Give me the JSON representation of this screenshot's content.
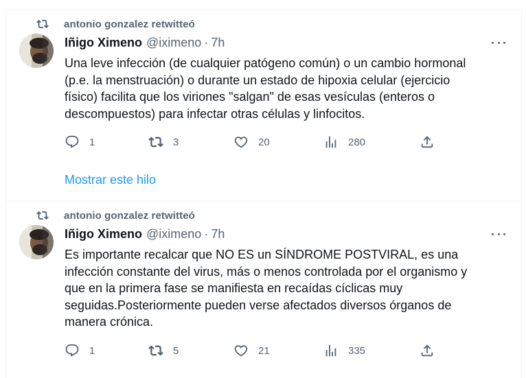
{
  "colors": {
    "text": "#0f1419",
    "muted": "#536471",
    "link": "#1d9bf0",
    "divider": "#eff3f4"
  },
  "tweets": [
    {
      "retweet_text": "antonio gonzalez retwitteó",
      "name": "Iñigo Ximeno",
      "handle": "@iximeno",
      "separator": "·",
      "time": "7h",
      "lines": [
        "Una leve infección (de cualquier patógeno común) o un cambio hormonal",
        "(p.e. la menstruación) o durante un estado de hipoxia celular (ejercicio",
        "físico) facilita que los viriones \"salgan\" de esas vesículas (enteros o",
        "descompuestos) para infectar otras células y linfocitos."
      ],
      "replies": "1",
      "retweets": "3",
      "likes": "20",
      "views": "280",
      "show_thread": "Mostrar este hilo"
    },
    {
      "retweet_text": "antonio gonzalez retwitteó",
      "name": "Iñigo Ximeno",
      "handle": "@iximeno",
      "separator": "·",
      "time": "7h",
      "lines": [
        "Es importante recalcar que NO ES un SÍNDROME POSTVIRAL, es una",
        "infección constante del virus, más o menos controlada por el organismo y",
        "que en la primera fase se manifiesta en recaídas cíclicas muy",
        "seguidas.Posteriormente pueden verse afectados diversos órganos de",
        "manera crónica."
      ],
      "replies": "1",
      "retweets": "5",
      "likes": "21",
      "views": "335"
    }
  ],
  "icons": {
    "retweet_indicator": "retweet-icon",
    "reply": "reply-icon",
    "retweet": "retweet-icon",
    "like": "heart-icon",
    "views": "views-chart-icon",
    "share": "share-icon",
    "more": "more-dots-icon"
  }
}
